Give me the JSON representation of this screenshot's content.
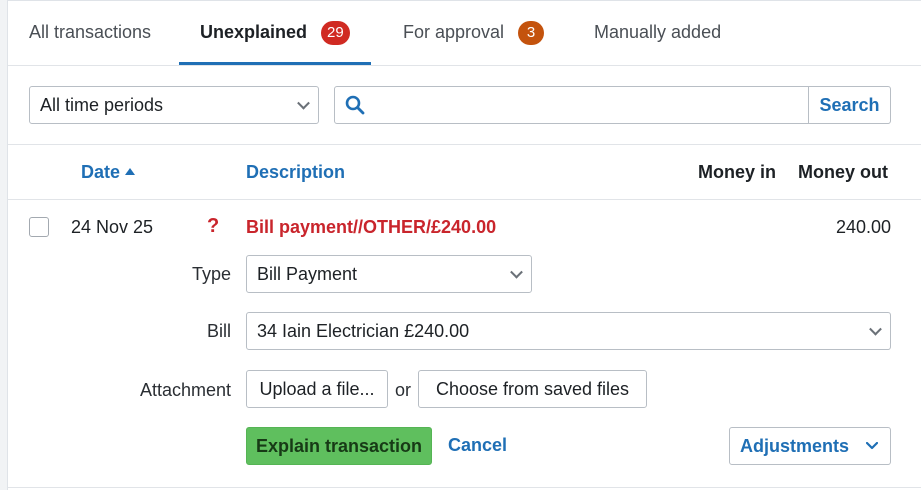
{
  "tabs": [
    {
      "label": "All transactions"
    },
    {
      "label": "Unexplained",
      "count": "29"
    },
    {
      "label": "For approval",
      "count": "3"
    },
    {
      "label": "Manually added"
    }
  ],
  "colors": {
    "accent": "#1f6fb5",
    "badge_red": "#d02a22",
    "badge_orange": "#c4530d",
    "alert_red": "#c9252c",
    "primary_green": "#5fbf5e"
  },
  "filters": {
    "period_select": "All time periods",
    "search_placeholder": "",
    "search_button": "Search"
  },
  "columns": {
    "date": "Date",
    "description": "Description",
    "money_in": "Money in",
    "money_out": "Money out"
  },
  "transaction": {
    "date": "24 Nov 25",
    "status_icon": "?",
    "description": "Bill payment//OTHER/£240.00",
    "money_in": "",
    "money_out": "240.00",
    "form": {
      "type_label": "Type",
      "type_value": "Bill Payment",
      "bill_label": "Bill",
      "bill_value": "34 Iain Electrician £240.00",
      "attachment_label": "Attachment",
      "upload_button": "Upload a file...",
      "or_text": "or",
      "choose_button": "Choose from saved files",
      "explain_button": "Explain transaction",
      "cancel_link": "Cancel",
      "adjustments_button": "Adjustments"
    }
  }
}
